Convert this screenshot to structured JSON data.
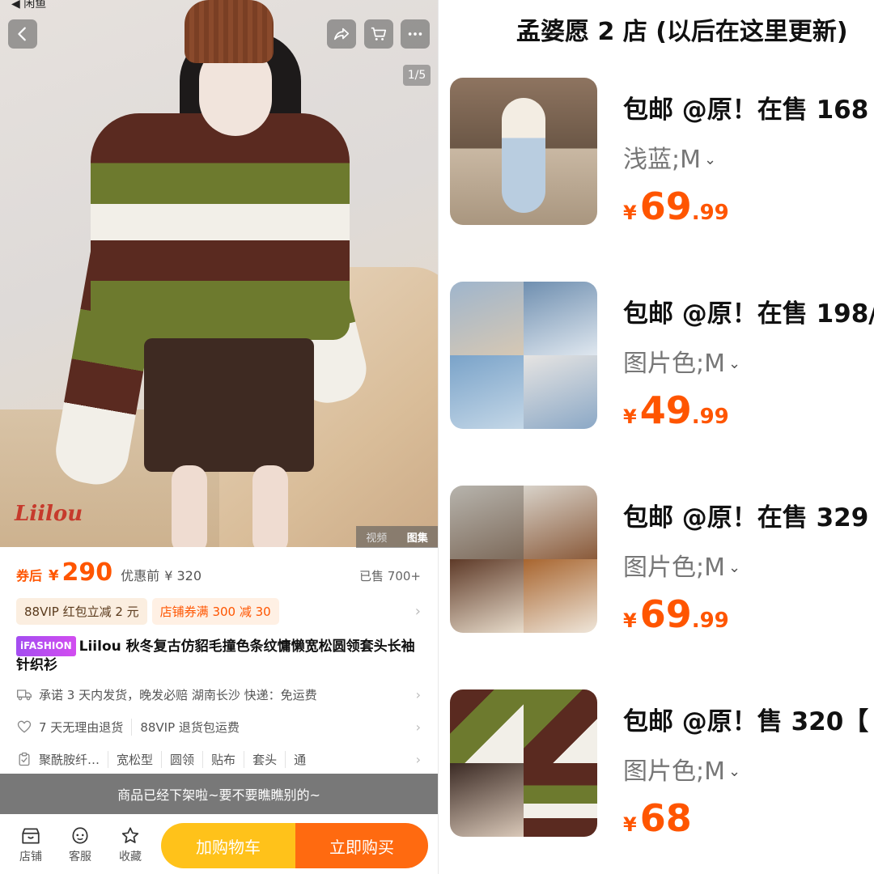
{
  "left": {
    "status_app": "◀ 闲鱼",
    "brand_logo": "Liilou",
    "image_counter": "1/5",
    "media_tabs": [
      "视频",
      "图集"
    ],
    "price": {
      "after_label": "券后",
      "currency": "¥",
      "after_price": "290",
      "before_label": "优惠前",
      "before_price": "¥ 320",
      "sold": "已售 700+"
    },
    "tags": {
      "vip": "88VIP 红包立减 2 元",
      "shop": "店铺券满 300 减 30"
    },
    "title": {
      "badge": "iFASHION",
      "text": "Liilou 秋冬复古仿貂毛撞色条纹慵懒宽松圆领套头长袖针织衫"
    },
    "shipping": "承诺 3 天内发货，晚发必赔  湖南长沙  快递：免运费",
    "returns": [
      "7 天无理由退货",
      "88VIP 退货包运费"
    ],
    "specs": [
      "聚酰胺纤…",
      "宽松型",
      "圆领",
      "贴布",
      "套头",
      "通"
    ],
    "offline_notice": "商品已经下架啦~要不要瞧瞧别的~",
    "bottom": {
      "store": "店铺",
      "service": "客服",
      "favorite": "收藏",
      "add_cart": "加购物车",
      "buy_now": "立即购买"
    }
  },
  "right": {
    "store_title": "孟婆愿 2 店 (以后在这里更新)",
    "items": [
      {
        "title": "包邮 @原！在售 168",
        "sku": "浅蓝;M",
        "price_yen": "¥",
        "price_int": "69",
        "price_dec": ".99"
      },
      {
        "title": "包邮 @原！在售 198/",
        "sku": "图片色;M",
        "price_yen": "¥",
        "price_int": "49",
        "price_dec": ".99"
      },
      {
        "title": "包邮 @原！在售 329",
        "sku": "图片色;M",
        "price_yen": "¥",
        "price_int": "69",
        "price_dec": ".99"
      },
      {
        "title": "包邮 @原！售 320【 ",
        "sku": "图片色;M",
        "price_yen": "¥",
        "price_int": "68",
        "price_dec": ""
      }
    ]
  },
  "colors": {
    "accent": "#ff5500",
    "cart_button": "#ffc21a",
    "buy_button": "#ff6a10"
  },
  "icons": {
    "back": "chevron-left-icon",
    "share": "share-icon",
    "cart": "cart-icon",
    "more": "more-icon",
    "truck": "truck-icon",
    "heart": "heart-icon",
    "clipboard": "clipboard-icon",
    "store": "store-icon",
    "service": "service-icon",
    "favorite": "star-icon"
  }
}
